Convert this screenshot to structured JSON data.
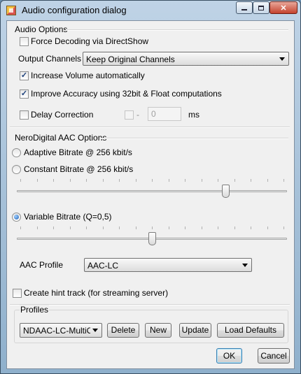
{
  "window": {
    "title": "Audio configuration dialog"
  },
  "audio_options": {
    "group_label": "Audio Options",
    "force_decoding": {
      "label": "Force Decoding via DirectShow",
      "checked": false
    },
    "output_channels": {
      "label": "Output Channels",
      "value": "Keep Original Channels"
    },
    "increase_volume": {
      "label": "Increase Volume automatically",
      "checked": true
    },
    "improve_accuracy": {
      "label": "Improve Accuracy using 32bit & Float computations",
      "checked": true
    },
    "delay_correction": {
      "label": "Delay Correction",
      "checked": false,
      "sign": "-",
      "value": "0",
      "unit": "ms"
    }
  },
  "nerodigital": {
    "group_label": "NeroDigital AAC Options",
    "adaptive": {
      "label": "Adaptive Bitrate @ 256 kbit/s",
      "selected": false
    },
    "constant": {
      "label": "Constant Bitrate @ 256 kbit/s",
      "selected": false,
      "slider_fraction": 0.78
    },
    "variable": {
      "label": "Variable Bitrate (Q=0,5)",
      "selected": true,
      "slider_fraction": 0.5
    },
    "aac_profile": {
      "label": "AAC Profile",
      "value": "AAC-LC"
    },
    "hint_track": {
      "label": "Create hint track (for streaming server)",
      "checked": false
    }
  },
  "profiles": {
    "group_label": "Profiles",
    "selected": "NDAAC-LC-MultiCha",
    "delete_label": "Delete",
    "new_label": "New",
    "update_label": "Update",
    "load_defaults_label": "Load Defaults"
  },
  "footer": {
    "ok_label": "OK",
    "cancel_label": "Cancel"
  }
}
